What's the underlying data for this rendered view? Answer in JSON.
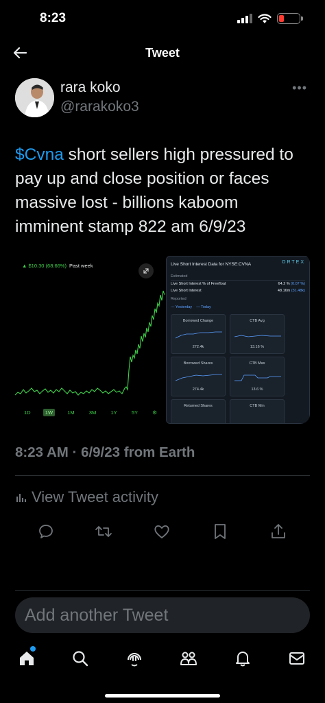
{
  "status_bar": {
    "time": "8:23"
  },
  "header": {
    "title": "Tweet"
  },
  "author": {
    "name": "rara koko",
    "handle": "@rarakoko3"
  },
  "tweet": {
    "cashtag": "$Cvna",
    "text_rest": " short sellers high pressured to pay up and close position or faces massive lost - billions kaboom imminent stamp 822 am 6/9/23"
  },
  "media": {
    "stock_chart": {
      "gain": "▲ $10.30 (68.66%)",
      "period": "Past week",
      "ranges": [
        "1D",
        "1W",
        "1M",
        "3M",
        "1Y",
        "5Y"
      ],
      "active_range": "1W"
    },
    "ortex": {
      "title": "Live Short Interest Data for NYSE:CVNA",
      "logo": "ORTEX",
      "estimated_label": "Estimated",
      "row1_label": "Live Short Interest % of Freefloat",
      "row1_value": "64.2 %",
      "row1_change": "(0.07 %)",
      "row2_label": "Live Short Interest",
      "row2_value": "48.16m",
      "row2_change": "(31.48k)",
      "reported_label": "Reported",
      "legend_yesterday": "--- Yesterday",
      "legend_today": "— Today",
      "tiles": [
        {
          "label": "Borrowed Change",
          "value": "272.4k"
        },
        {
          "label": "CTB Avg",
          "value": "13.16 %"
        },
        {
          "label": "Borrowed Shares",
          "value": "274.4k"
        },
        {
          "label": "CTB Max",
          "value": "13.6 %"
        },
        {
          "label": "Returned Shares",
          "value": ""
        },
        {
          "label": "CTB Min",
          "value": ""
        }
      ]
    }
  },
  "timestamp": {
    "time": "8:23 AM · 6/9/23",
    "source": " from Earth"
  },
  "activity": {
    "label": "View Tweet activity"
  },
  "compose": {
    "placeholder": "Add another Tweet"
  },
  "colors": {
    "accent": "#1d9bf0",
    "background": "#000000",
    "muted": "#71767b",
    "chart_green": "#3fd24a"
  },
  "icons": {
    "actions": [
      "reply-icon",
      "retweet-icon",
      "like-icon",
      "bookmark-icon",
      "share-icon"
    ],
    "tabs": [
      "home-icon",
      "search-icon",
      "spaces-icon",
      "communities-icon",
      "notifications-icon",
      "messages-icon"
    ]
  }
}
